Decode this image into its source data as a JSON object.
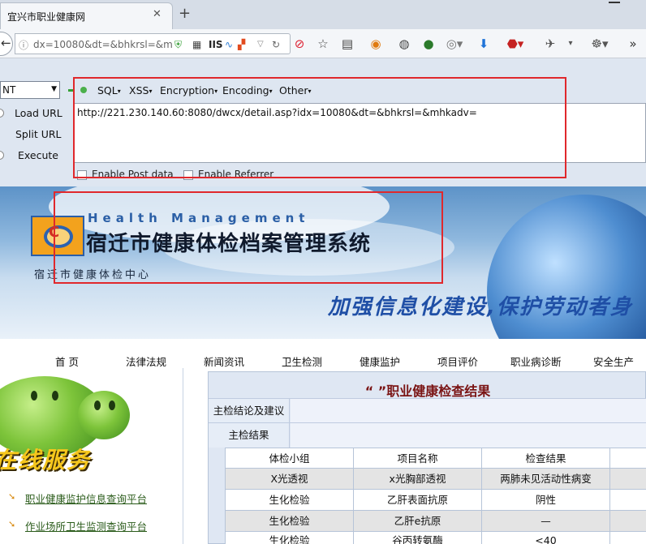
{
  "browser": {
    "tab_title": "宜兴市职业健康网",
    "url": "dx=10080&dt=&bhkrsl=&m",
    "addon_iis": "IIS"
  },
  "hackbar": {
    "select_value": "NT",
    "menus": [
      {
        "label": "SQL"
      },
      {
        "label": "XSS"
      },
      {
        "label": "Encryption"
      },
      {
        "label": "Encoding"
      },
      {
        "label": "Other"
      }
    ],
    "actions": [
      {
        "label": "Load URL"
      },
      {
        "label": "Split URL"
      },
      {
        "label": "Execute"
      }
    ],
    "url_value": "http://221.230.140.60:8080/dwcx/detail.asp?idx=10080&dt=&bhkrsl=&mhkadv=",
    "enable_post": "Enable Post data",
    "enable_referrer": "Enable Referrer"
  },
  "banner": {
    "health_en": "Health Management",
    "system_title": "宿迁市健康体检档案管理系统",
    "subtitle": "宿迁市健康体检中心",
    "slogan": "加强信息化建设,保护劳动者身"
  },
  "site_nav": [
    {
      "label": "首 页"
    },
    {
      "label": "法律法规"
    },
    {
      "label": "新闻资讯"
    },
    {
      "label": "卫生检测"
    },
    {
      "label": "健康监护"
    },
    {
      "label": "项目评价"
    },
    {
      "label": "职业病诊断"
    },
    {
      "label": "安全生产"
    }
  ],
  "left": {
    "online_service": "在线服务",
    "links": [
      {
        "label": "职业健康监护信息查询平台"
      },
      {
        "label": "作业场所卫生监测查询平台"
      }
    ]
  },
  "result": {
    "title": "“ ”职业健康检查结果",
    "conclusion_label": "主检结论及建议",
    "main_result_label": "主检结果",
    "columns": [
      "体检小组",
      "项目名称",
      "检查结果"
    ],
    "rows": [
      [
        "X光透视",
        "x光胸部透视",
        "两肺未见活动性病变"
      ],
      [
        "生化检验",
        "乙肝表面抗原",
        "阴性"
      ],
      [
        "生化检验",
        "乙肝e抗原",
        "—"
      ],
      [
        "生化检验",
        "谷丙转氨酶",
        "<40"
      ]
    ]
  },
  "colors": {
    "accent_red": "#e0282c",
    "hackbar_bg": "#dee6f1",
    "title_red": "#7a1414"
  }
}
